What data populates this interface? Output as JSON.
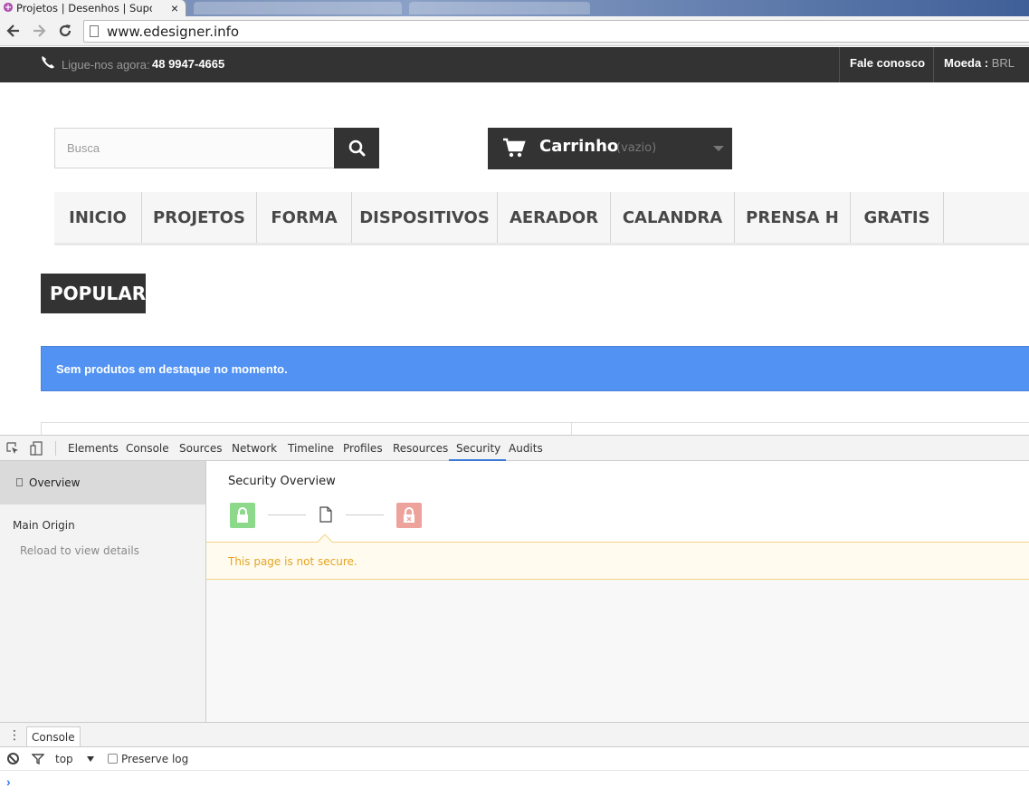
{
  "browser": {
    "active_tab_title": "Projetos | Desenhos | Supo",
    "close_glyph": "×",
    "url": "www.edesigner.info"
  },
  "site": {
    "topbar": {
      "phone_label": "Ligue-nos agora:",
      "phone_number": "48 9947-4665",
      "contact_link": "Fale conosco",
      "currency_label": "Moeda :",
      "currency_value": "BRL"
    },
    "search": {
      "placeholder": "Busca"
    },
    "cart": {
      "title": "Carrinho",
      "status": "(vazio)"
    },
    "menu": [
      {
        "label": "INICIO"
      },
      {
        "label": "PROJETOS"
      },
      {
        "label": "FORMA"
      },
      {
        "label": "DISPOSITIVOS"
      },
      {
        "label": "AERADOR"
      },
      {
        "label": "CALANDRA"
      },
      {
        "label": "PRENSA H"
      },
      {
        "label": "GRATIS"
      }
    ],
    "popular_title": "POPULAR",
    "alert_text": "Sem produtos em destaque no momento.",
    "colors": {
      "dark": "#333333",
      "alert_blue": "#5192f3"
    }
  },
  "devtools": {
    "tabs": [
      {
        "label": "Elements"
      },
      {
        "label": "Console"
      },
      {
        "label": "Sources"
      },
      {
        "label": "Network"
      },
      {
        "label": "Timeline"
      },
      {
        "label": "Profiles"
      },
      {
        "label": "Resources"
      },
      {
        "label": "Security"
      },
      {
        "label": "Audits"
      }
    ],
    "active_tab": "Security",
    "sidebar": {
      "overview": "Overview",
      "main_origin": "Main Origin",
      "reload_hint": "Reload to view details"
    },
    "security": {
      "title": "Security Overview",
      "warning": "This page is not secure."
    },
    "drawer": {
      "tab": "Console",
      "context": "top",
      "preserve_log": "Preserve log",
      "prompt": "›"
    }
  }
}
